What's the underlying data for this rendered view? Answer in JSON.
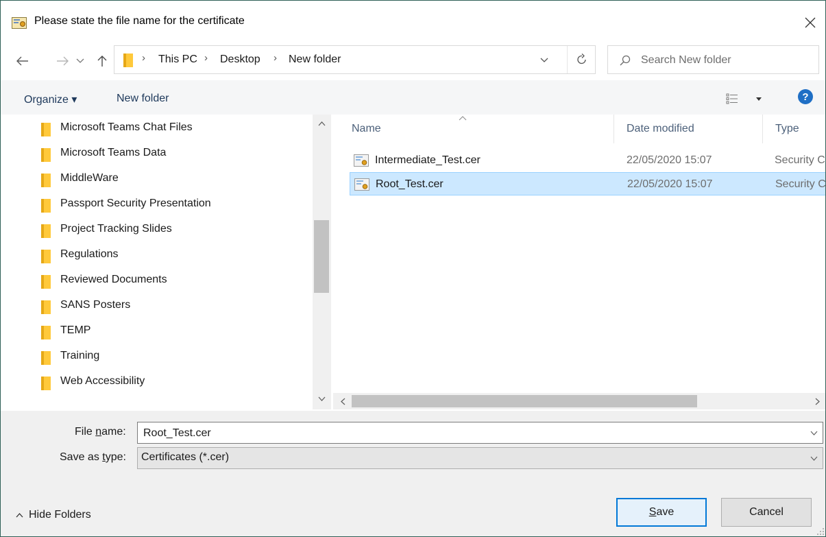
{
  "window": {
    "title": "Please state the file name for the certificate",
    "close_label": "✕"
  },
  "navigation": {
    "back_icon": "back-arrow-icon",
    "forward_icon": "forward-arrow-icon",
    "recent_icon": "chevron-down-icon",
    "up_icon": "up-arrow-icon",
    "breadcrumbs": [
      "This PC",
      "Desktop",
      "New folder"
    ],
    "search_placeholder": "Search New folder"
  },
  "toolbar": {
    "organize_label": "Organize ▾",
    "new_folder_label": "New folder",
    "help_label": "?"
  },
  "nav_pane": {
    "items": [
      {
        "label": "Microsoft Teams Chat Files"
      },
      {
        "label": "Microsoft Teams Data"
      },
      {
        "label": "MiddleWare"
      },
      {
        "label": "Passport Security Presentation"
      },
      {
        "label": "Project Tracking Slides"
      },
      {
        "label": "Regulations"
      },
      {
        "label": "Reviewed Documents"
      },
      {
        "label": "SANS Posters"
      },
      {
        "label": "TEMP"
      },
      {
        "label": "Training"
      },
      {
        "label": "Web Accessibility"
      }
    ]
  },
  "file_list": {
    "columns": [
      "Name",
      "Date modified",
      "Type"
    ],
    "rows": [
      {
        "name": "Intermediate_Test.cer",
        "date": "22/05/2020 15:07",
        "type": "Security Certificate",
        "selected": false
      },
      {
        "name": "Root_Test.cer",
        "date": "22/05/2020 15:07",
        "type": "Security Certificate",
        "selected": true
      }
    ]
  },
  "form": {
    "file_name_label_pre": "File ",
    "file_name_label_key": "n",
    "file_name_label_post": "ame:",
    "file_name_value": "Root_Test.cer",
    "save_type_label_pre": "Save as ",
    "save_type_label_key": "t",
    "save_type_label_post": "ype:",
    "save_type_value": "Certificates (*.cer)",
    "hide_folders_label": "Hide Folders",
    "save_key": "S",
    "save_rest": "ave",
    "cancel_label": "Cancel"
  },
  "colors": {
    "accent": "#0078d7",
    "selection_bg": "#cce8ff",
    "selection_border": "#99d1ff",
    "help_blue": "#1f6fc5",
    "folder_yellow": "#ffc93b"
  }
}
